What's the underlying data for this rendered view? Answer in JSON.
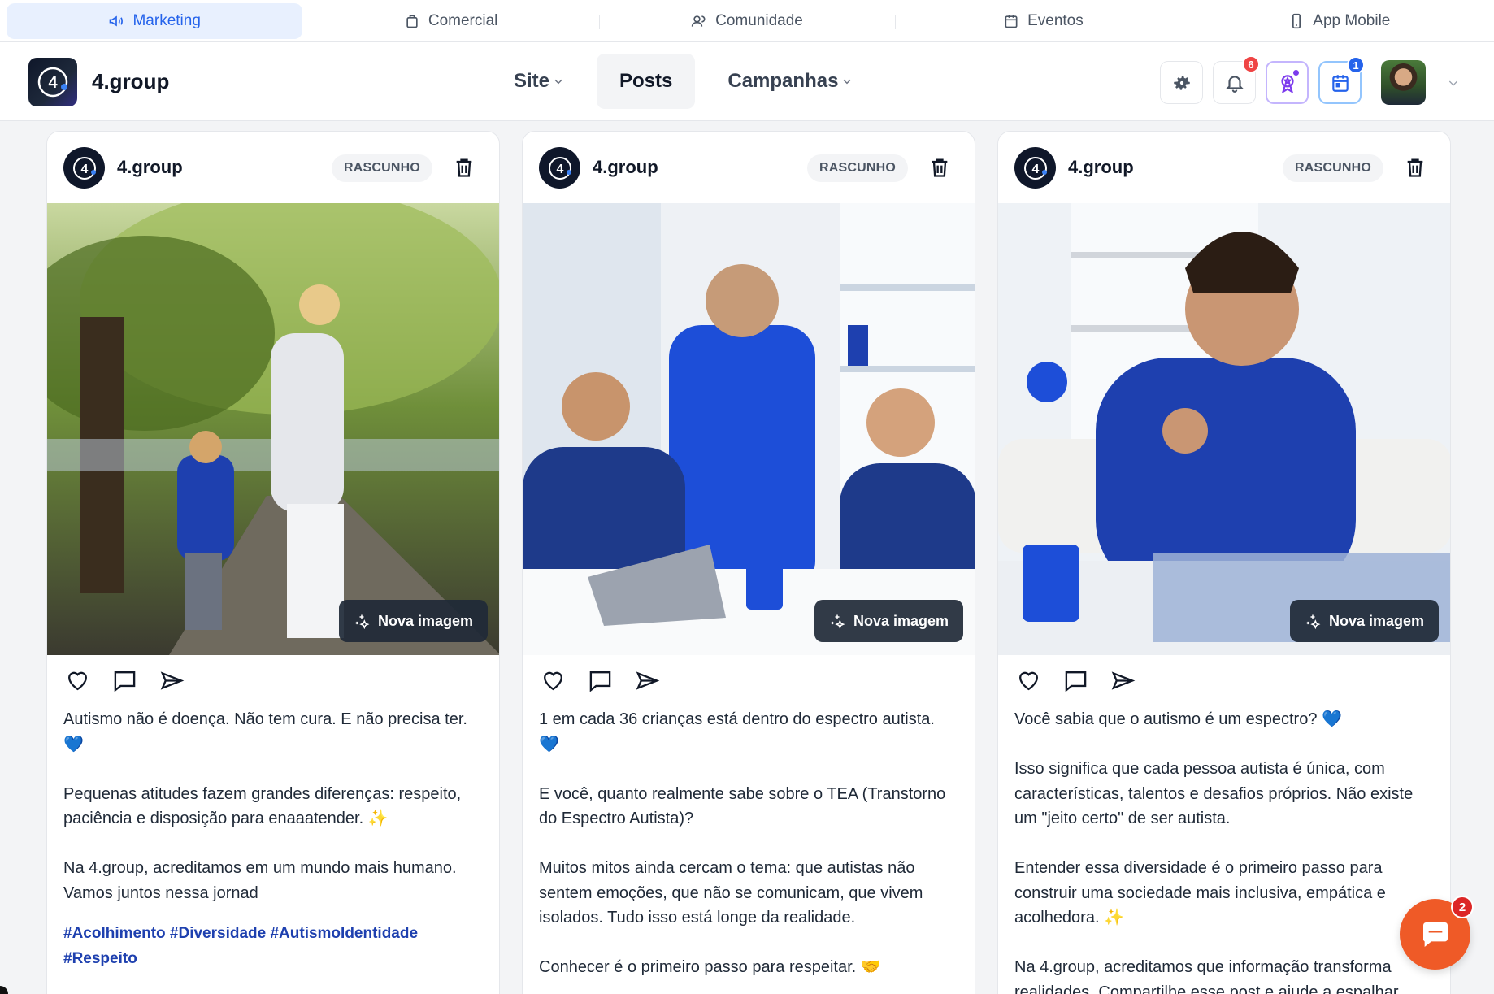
{
  "top_tabs": [
    {
      "label": "Marketing",
      "icon": "megaphone-icon",
      "active": true
    },
    {
      "label": "Comercial",
      "icon": "briefcase-icon",
      "active": false
    },
    {
      "label": "Comunidade",
      "icon": "users-icon",
      "active": false
    },
    {
      "label": "Eventos",
      "icon": "calendar-icon",
      "active": false
    },
    {
      "label": "App Mobile",
      "icon": "smartphone-icon",
      "active": false
    }
  ],
  "header": {
    "logo_text": "4",
    "brand": "4.group",
    "nav": [
      {
        "label": "Site",
        "dropdown": true,
        "active": false
      },
      {
        "label": "Posts",
        "dropdown": false,
        "active": true
      },
      {
        "label": "Campanhas",
        "dropdown": true,
        "active": false
      }
    ],
    "notifications_count": "6",
    "calendar_count": "1"
  },
  "posts": [
    {
      "account": "4.group",
      "status": "RASCUNHO",
      "image_button": "Nova imagem",
      "paragraphs": [
        "Autismo não é doença. Não tem cura. E não precisa ter.\n💙",
        "Pequenas atitudes fazem grandes diferenças: respeito,\npaciência e disposição para enaaatender. ✨",
        "Na 4.group, acreditamos em um mundo mais humano.\nVamos juntos nessa jornad"
      ],
      "hashtags": "#Acolhimento #Diversidade #AutismoIdentidade\n#Respeito"
    },
    {
      "account": "4.group",
      "status": "RASCUNHO",
      "image_button": "Nova imagem",
      "paragraphs": [
        "1 em cada 36 crianças está dentro do espectro autista.\n💙",
        "E você, quanto realmente sabe sobre o TEA (Transtorno\ndo Espectro Autista)?",
        "Muitos mitos ainda cercam o tema: que autistas não\nsentem emoções, que não se comunicam, que vivem\nisolados. Tudo isso está longe da realidade.",
        "Conhecer é o primeiro passo para respeitar. 🤝"
      ],
      "hashtags": ""
    },
    {
      "account": "4.group",
      "status": "RASCUNHO",
      "image_button": "Nova imagem",
      "paragraphs": [
        "Você sabia que o autismo é um espectro? 💙",
        "Isso significa que cada pessoa autista é única, com\ncaracterísticas, talentos e desafios próprios. Não existe\num \"jeito certo\" de ser autista.",
        "Entender essa diversidade é o primeiro passo para\nconstruir uma sociedade mais inclusiva, empática e\nacolhedora. ✨",
        "Na 4.group, acreditamos que informação transforma\nrealidades. Compartilhe esse post e ajude a espalhar"
      ],
      "hashtags": ""
    }
  ],
  "chat": {
    "unread_count": "2"
  },
  "colors": {
    "accent": "#2563eb",
    "chat": "#ef5a27",
    "badge_red": "#ef4444",
    "badge_blue": "#2563eb",
    "hashtag": "#1e40af"
  }
}
